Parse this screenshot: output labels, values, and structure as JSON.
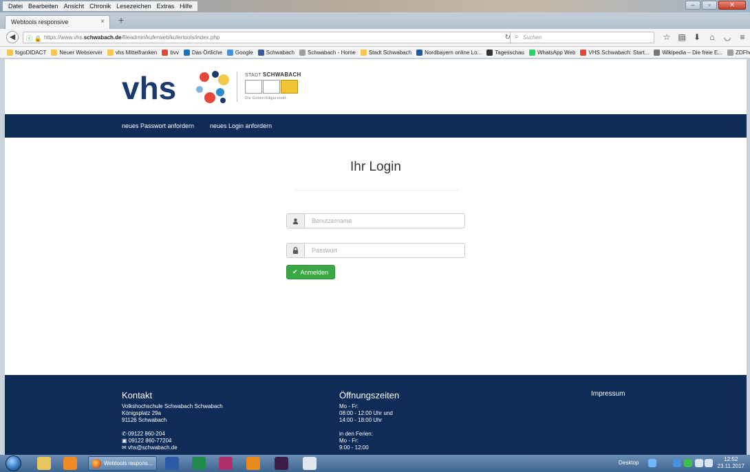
{
  "browser": {
    "menu": [
      "Datei",
      "Bearbeiten",
      "Ansicht",
      "Chronik",
      "Lesezeichen",
      "Extras",
      "Hilfe"
    ],
    "tab_title": "Webtools responsive",
    "url_prefix": "https://www.vhs.",
    "url_domain": "schwabach.de",
    "url_path": "/fileadmin/kuferweb/kufertools/index.php",
    "search_placeholder": "Suchen",
    "bookmarks": [
      {
        "label": "fogoDIDACT",
        "color": "#f2c94c"
      },
      {
        "label": "Neuer Webserver",
        "color": "#f2c94c"
      },
      {
        "label": "vhs Mittelfranken",
        "color": "#f2c94c"
      },
      {
        "label": "bvv",
        "color": "#e5473a"
      },
      {
        "label": "Das Örtliche",
        "color": "#1e73be"
      },
      {
        "label": "Google",
        "color": "#4a90d9"
      },
      {
        "label": "Schwabach",
        "color": "#3b5998"
      },
      {
        "label": "Schwabach - Home",
        "color": "#9e9e9e"
      },
      {
        "label": "Stadt Schwabach",
        "color": "#f2c94c"
      },
      {
        "label": "Nordbayern online Lo...",
        "color": "#1e5aa8"
      },
      {
        "label": "Tagesschau",
        "color": "#333333"
      },
      {
        "label": "WhatsApp Web",
        "color": "#25d366"
      },
      {
        "label": "VHS Schwabach: Start...",
        "color": "#e5473a"
      },
      {
        "label": "Wikipedia – Die freie E...",
        "color": "#777777"
      },
      {
        "label": "ZDFheute",
        "color": "#9e9e9e"
      }
    ]
  },
  "site": {
    "logo_text": "vhs",
    "stadt_label_prefix": "STADT ",
    "stadt_label_name": "SCHWABACH",
    "stadt_sub": "Die Goldschlägerstadt.",
    "nav": [
      "neues Passwort anfordern",
      "neues Login anfordern"
    ],
    "login_title": "Ihr Login",
    "username_placeholder": "Benutzername",
    "password_placeholder": "Passwort",
    "login_button": "Anmelden",
    "footer": {
      "contact_title": "Kontakt",
      "contact_lines": [
        "Volkshochschule Schwabach Schwabach",
        "Königsplatz 29a",
        "91126 Schwabach"
      ],
      "phone": "09122 860-204",
      "fax": "09122 860-77204",
      "email": "vhs@schwabach.de",
      "hours_title": "Öffnungszeiten",
      "hours_lines": [
        "Mo - Fr:",
        "08:00 - 12:00 Uhr und",
        "14:00 - 18:00 Uhr"
      ],
      "holiday_lines": [
        "in den Ferien:",
        "Mo - Fr:",
        "9:00 - 12:00"
      ],
      "impressum": "Impressum"
    }
  },
  "taskbar": {
    "active_window": "Webtools respons...",
    "desktop_label": "Desktop",
    "time": "12:52",
    "date": "23.11.2017"
  }
}
